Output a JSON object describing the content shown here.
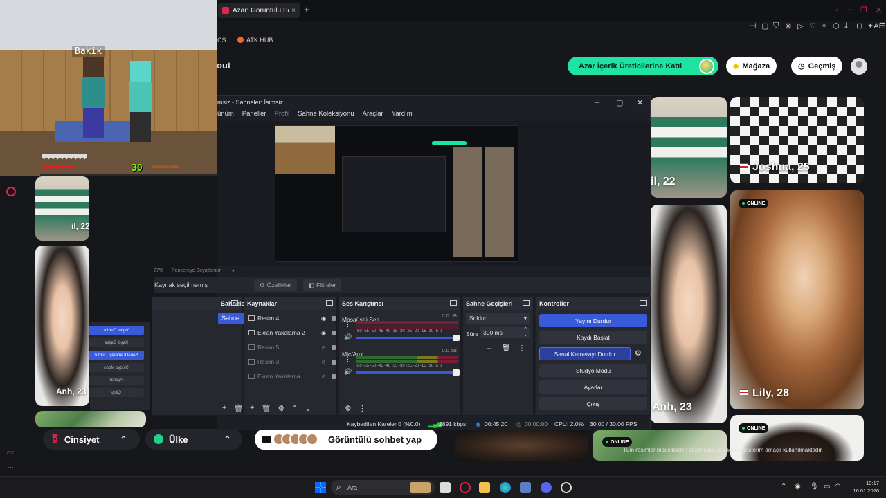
{
  "browser": {
    "tab_title": "Azar: Görüntülü Sohbet &",
    "new_tab": "+",
    "bookmarks": {
      "truncated": "CS...",
      "atk": "ATK HUB"
    },
    "toolbar_ai": "AI"
  },
  "page": {
    "logo_fragment": "out",
    "creator_cta": "Azar İçerik Üreticilerine Katıl",
    "shop": "Mağaza",
    "history": "Geçmiş",
    "cards": {
      "c1_label": "il, 22",
      "c2_label": "Joshua, 25",
      "c3_label": "Anh, 23",
      "c4_label": "Lily, 28",
      "left_label": "il, 22",
      "left2_label": "Anh, 23",
      "online": "ONLINE"
    },
    "tos": "Tüm resimler modellerden oluşmakta ve sadece gösterim amaçlı kullanılmaktadır.",
    "filter_gender": "Cinsiyet",
    "filter_country": "Ülke",
    "video_chat": "Görüntülü sohbet yap"
  },
  "minecraft": {
    "nametag": "Bakik",
    "level": "30"
  },
  "obs": {
    "title": "msiz - Sahneler: İsimsiz",
    "menu": [
      "ünüm",
      "Paneller",
      "Profil",
      "Sahne Koleksiyonu",
      "Araçlar",
      "Yardım"
    ],
    "zoom": "27%",
    "zoom_mode": "Pencereye Boyutlandır",
    "no_source": "Kaynak seçilmemiş",
    "properties": "Özellikler",
    "filters": "Filtreler",
    "scenes": {
      "title": "Sahneler",
      "items": [
        "Sahne"
      ]
    },
    "sources": {
      "title": "Kaynaklar",
      "items": [
        "Resim 4",
        "Ekran Yakalama 2",
        "Resim 5",
        "Resim 3",
        "Ekran Yakalama"
      ]
    },
    "mixer": {
      "title": "Ses Karıştırıcı",
      "ch1_name": "Masaüstü Ses",
      "ch1_db": "0.0 dB",
      "ch2_name": "Mic/Aux",
      "ch2_db": "0.0 dB",
      "scale": "-60 -55 -50 -45 -40 -35 -30 -25 -20 -15 -10 -5 0"
    },
    "transitions": {
      "title": "Sahne Geçişleri",
      "type": "Soldur",
      "duration_label": "Süre",
      "duration": "300 ms"
    },
    "controls": {
      "title": "Kontroller",
      "stop_stream": "Yayını Durdur",
      "start_record": "Kaydı Başlat",
      "stop_virtualcam": "Sanal Kamerayı Durdur",
      "studio_mode": "Stüdyo Modu",
      "settings": "Ayarlar",
      "exit": "Çıkış"
    },
    "status": {
      "dropped": "Kaybedilen Kareler 0 (%0.0)",
      "bitrate": "2891 kbps",
      "stream_time": "00:45:20",
      "rec_time": "00:00:00",
      "cpu": "CPU: 2.0%",
      "fps": "30.00 / 30.00 FPS"
    },
    "mirrored": [
      "Yayını Durdur",
      "Kaydı Başlat",
      "Sanal Kamerayı Durdur",
      "Stüdyo Modu",
      "Ayarlar",
      "Çıkış"
    ]
  },
  "taskbar": {
    "search": "Ara",
    "time": "19:17",
    "date": "16.01.2026"
  },
  "colors": {
    "accent_blue": "#3a5bd9",
    "azar_green": "#1fe3a0",
    "brand_red": "#e2254a"
  }
}
